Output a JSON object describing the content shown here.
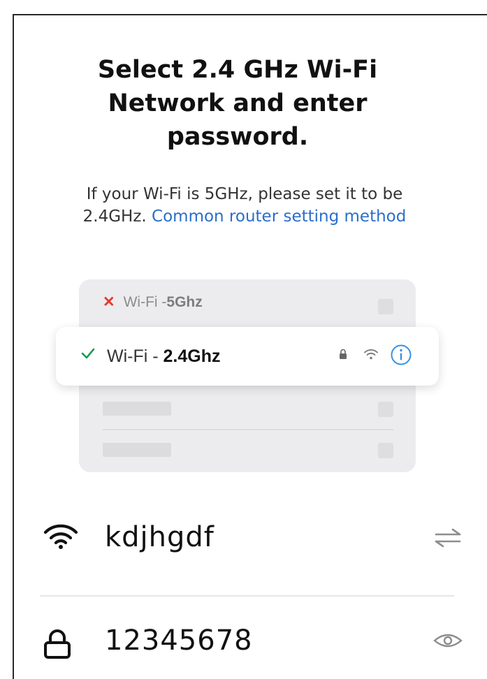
{
  "header": {
    "title_line1": "Select 2.4 GHz Wi-Fi",
    "title_line2": "Network and enter",
    "title_line3": "password."
  },
  "notice": {
    "text_line1": "If your Wi-Fi is 5GHz, please set it to be",
    "text_prefix2": "2.4GHz. ",
    "link_text": "Common router setting method"
  },
  "illustration": {
    "bad_network_prefix": "Wi-Fi - ",
    "bad_network_band": "5Ghz",
    "good_network_prefix": "Wi-Fi - ",
    "good_network_band": "2.4Ghz"
  },
  "form": {
    "ssid_value": "kdjhgdf",
    "password_value": "12345678"
  },
  "icons": {
    "bad": "close-icon",
    "good": "check-icon",
    "lock": "lock-icon",
    "wifi": "wifi-icon",
    "info": "info-icon",
    "switch": "switch-icon",
    "eye": "eye-icon"
  },
  "colors": {
    "link": "#2a6fc9",
    "error": "#e23a2e",
    "success": "#1e9a56",
    "info": "#3b8fe0"
  }
}
